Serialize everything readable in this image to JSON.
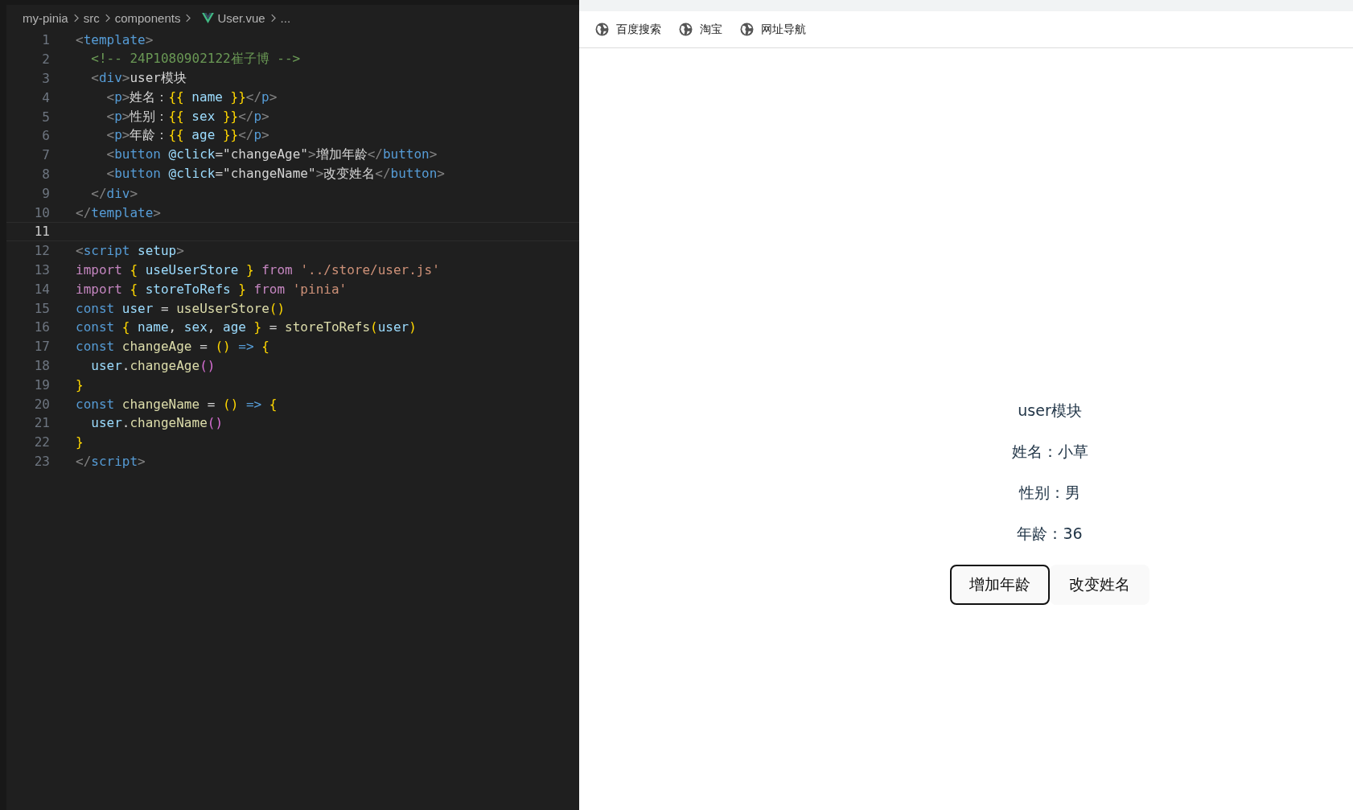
{
  "editor": {
    "breadcrumb": [
      {
        "text": "my-pinia",
        "kind": "folder"
      },
      {
        "text": "src",
        "kind": "folder"
      },
      {
        "text": "components",
        "kind": "folder"
      },
      {
        "text": "User.vue",
        "kind": "vue"
      },
      {
        "text": "...",
        "kind": "more"
      }
    ],
    "lines": [
      {
        "number": "1",
        "active": false,
        "tokens": [
          {
            "kind": "punct",
            "text": "<"
          },
          {
            "kind": "tag",
            "text": "template"
          },
          {
            "kind": "punct",
            "text": ">"
          }
        ]
      },
      {
        "number": "2",
        "active": false,
        "tokens": [
          {
            "kind": "comment",
            "text": "  <!-- 24P1080902122崔子博 -->"
          }
        ]
      },
      {
        "number": "3",
        "active": false,
        "tokens": [
          {
            "kind": "punct",
            "text": "  <"
          },
          {
            "kind": "tag",
            "text": "div"
          },
          {
            "kind": "punct",
            "text": ">"
          },
          {
            "kind": "text",
            "text": "user模块"
          }
        ]
      },
      {
        "number": "4",
        "active": false,
        "tokens": [
          {
            "kind": "punct",
            "text": "    <"
          },
          {
            "kind": "tag",
            "text": "p"
          },
          {
            "kind": "punct",
            "text": ">"
          },
          {
            "kind": "text",
            "text": "姓名："
          },
          {
            "kind": "brace",
            "text": "{{ "
          },
          {
            "kind": "variable",
            "text": "name "
          },
          {
            "kind": "brace",
            "text": "}}"
          },
          {
            "kind": "punct",
            "text": "</"
          },
          {
            "kind": "tag",
            "text": "p"
          },
          {
            "kind": "punct",
            "text": ">"
          }
        ]
      },
      {
        "number": "5",
        "active": false,
        "tokens": [
          {
            "kind": "punct",
            "text": "    <"
          },
          {
            "kind": "tag",
            "text": "p"
          },
          {
            "kind": "punct",
            "text": ">"
          },
          {
            "kind": "text",
            "text": "性别："
          },
          {
            "kind": "brace",
            "text": "{{ "
          },
          {
            "kind": "variable",
            "text": "sex "
          },
          {
            "kind": "brace",
            "text": "}}"
          },
          {
            "kind": "punct",
            "text": "</"
          },
          {
            "kind": "tag",
            "text": "p"
          },
          {
            "kind": "punct",
            "text": ">"
          }
        ]
      },
      {
        "number": "6",
        "active": false,
        "tokens": [
          {
            "kind": "punct",
            "text": "    <"
          },
          {
            "kind": "tag",
            "text": "p"
          },
          {
            "kind": "punct",
            "text": ">"
          },
          {
            "kind": "text",
            "text": "年龄："
          },
          {
            "kind": "brace",
            "text": "{{ "
          },
          {
            "kind": "variable",
            "text": "age "
          },
          {
            "kind": "brace",
            "text": "}}"
          },
          {
            "kind": "punct",
            "text": "</"
          },
          {
            "kind": "tag",
            "text": "p"
          },
          {
            "kind": "punct",
            "text": ">"
          }
        ]
      },
      {
        "number": "7",
        "active": false,
        "tokens": [
          {
            "kind": "punct",
            "text": "    <"
          },
          {
            "kind": "tag",
            "text": "button "
          },
          {
            "kind": "attribute",
            "text": "@click"
          },
          {
            "kind": "text",
            "text": "=\"changeAge\""
          },
          {
            "kind": "punct",
            "text": ">"
          },
          {
            "kind": "text",
            "text": "增加年龄"
          },
          {
            "kind": "punct",
            "text": "</"
          },
          {
            "kind": "tag",
            "text": "button"
          },
          {
            "kind": "punct",
            "text": ">"
          }
        ]
      },
      {
        "number": "8",
        "active": false,
        "tokens": [
          {
            "kind": "punct",
            "text": "    <"
          },
          {
            "kind": "tag",
            "text": "button "
          },
          {
            "kind": "attribute",
            "text": "@click"
          },
          {
            "kind": "text",
            "text": "=\"changeName\""
          },
          {
            "kind": "punct",
            "text": ">"
          },
          {
            "kind": "text",
            "text": "改变姓名"
          },
          {
            "kind": "punct",
            "text": "</"
          },
          {
            "kind": "tag",
            "text": "button"
          },
          {
            "kind": "punct",
            "text": ">"
          }
        ]
      },
      {
        "number": "9",
        "active": false,
        "tokens": [
          {
            "kind": "punct",
            "text": "  </"
          },
          {
            "kind": "tag",
            "text": "div"
          },
          {
            "kind": "punct",
            "text": ">"
          }
        ]
      },
      {
        "number": "10",
        "active": false,
        "tokens": [
          {
            "kind": "punct",
            "text": "</"
          },
          {
            "kind": "tag",
            "text": "template"
          },
          {
            "kind": "punct",
            "text": ">"
          }
        ]
      },
      {
        "number": "11",
        "active": true
      },
      {
        "number": "12",
        "active": false,
        "tokens": [
          {
            "kind": "punct",
            "text": "<"
          },
          {
            "kind": "tag",
            "text": "script "
          },
          {
            "kind": "variable",
            "text": "setup"
          },
          {
            "kind": "punct",
            "text": ">"
          }
        ]
      },
      {
        "number": "13",
        "active": false,
        "tokens": [
          {
            "kind": "keyword",
            "text": "import "
          },
          {
            "kind": "brace",
            "text": "{ "
          },
          {
            "kind": "variable",
            "text": "useUserStore "
          },
          {
            "kind": "brace",
            "text": "} "
          },
          {
            "kind": "keyword",
            "text": "from "
          },
          {
            "kind": "string",
            "text": "'../store/user.js'"
          }
        ]
      },
      {
        "number": "14",
        "active": false,
        "tokens": [
          {
            "kind": "keyword",
            "text": "import "
          },
          {
            "kind": "brace",
            "text": "{ "
          },
          {
            "kind": "variable",
            "text": "storeToRefs "
          },
          {
            "kind": "brace",
            "text": "} "
          },
          {
            "kind": "keyword",
            "text": "from "
          },
          {
            "kind": "string",
            "text": "'pinia'"
          }
        ]
      },
      {
        "number": "15",
        "active": false,
        "tokens": [
          {
            "kind": "storage",
            "text": "const "
          },
          {
            "kind": "variable",
            "text": "user "
          },
          {
            "kind": "text",
            "text": "= "
          },
          {
            "kind": "function",
            "text": "useUserStore"
          },
          {
            "kind": "brace",
            "text": "()"
          }
        ]
      },
      {
        "number": "16",
        "active": false,
        "tokens": [
          {
            "kind": "storage",
            "text": "const "
          },
          {
            "kind": "brace",
            "text": "{ "
          },
          {
            "kind": "variable",
            "text": "name"
          },
          {
            "kind": "text",
            "text": ", "
          },
          {
            "kind": "variable",
            "text": "sex"
          },
          {
            "kind": "text",
            "text": ", "
          },
          {
            "kind": "variable",
            "text": "age "
          },
          {
            "kind": "brace",
            "text": "} "
          },
          {
            "kind": "text",
            "text": "= "
          },
          {
            "kind": "function",
            "text": "storeToRefs"
          },
          {
            "kind": "brace",
            "text": "("
          },
          {
            "kind": "variable",
            "text": "user"
          },
          {
            "kind": "brace",
            "text": ")"
          }
        ]
      },
      {
        "number": "17",
        "active": false,
        "tokens": [
          {
            "kind": "storage",
            "text": "const "
          },
          {
            "kind": "function",
            "text": "changeAge "
          },
          {
            "kind": "text",
            "text": "= "
          },
          {
            "kind": "brace",
            "text": "() "
          },
          {
            "kind": "storage",
            "text": "=> "
          },
          {
            "kind": "brace",
            "text": "{"
          }
        ]
      },
      {
        "number": "18",
        "active": false,
        "tokens": [
          {
            "kind": "variable",
            "text": "  user"
          },
          {
            "kind": "text",
            "text": "."
          },
          {
            "kind": "function",
            "text": "changeAge"
          },
          {
            "kind": "paren",
            "text": "()"
          }
        ]
      },
      {
        "number": "19",
        "active": false,
        "tokens": [
          {
            "kind": "brace",
            "text": "}"
          }
        ]
      },
      {
        "number": "20",
        "active": false,
        "tokens": [
          {
            "kind": "storage",
            "text": "const "
          },
          {
            "kind": "function",
            "text": "changeName "
          },
          {
            "kind": "text",
            "text": "= "
          },
          {
            "kind": "brace",
            "text": "() "
          },
          {
            "kind": "storage",
            "text": "=> "
          },
          {
            "kind": "brace",
            "text": "{"
          }
        ]
      },
      {
        "number": "21",
        "active": false,
        "tokens": [
          {
            "kind": "variable",
            "text": "  user"
          },
          {
            "kind": "text",
            "text": "."
          },
          {
            "kind": "function",
            "text": "changeName"
          },
          {
            "kind": "paren",
            "text": "()"
          }
        ]
      },
      {
        "number": "22",
        "active": false,
        "tokens": [
          {
            "kind": "brace",
            "text": "}"
          }
        ]
      },
      {
        "number": "23",
        "active": false,
        "tokens": [
          {
            "kind": "punct",
            "text": "</"
          },
          {
            "kind": "tag",
            "text": "script"
          },
          {
            "kind": "punct",
            "text": ">"
          }
        ]
      }
    ]
  },
  "browser": {
    "bookmarks": [
      {
        "label": "百度搜索"
      },
      {
        "label": "淘宝"
      },
      {
        "label": "网址导航"
      }
    ],
    "page": {
      "heading": "user模块",
      "paragraphs": [
        "姓名：小草",
        "性别：男",
        "年龄：36"
      ],
      "buttons": [
        {
          "label": "增加年龄",
          "focused": true
        },
        {
          "label": "改变姓名",
          "focused": false
        }
      ]
    }
  }
}
